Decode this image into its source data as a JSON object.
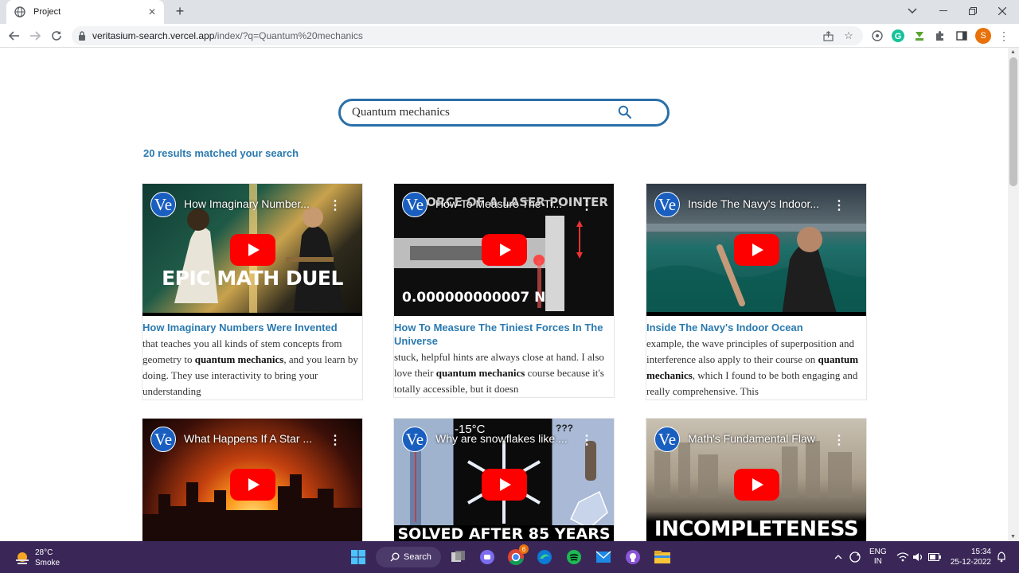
{
  "browser": {
    "tab_title": "Project",
    "url_host": "veritasium-search.vercel.app",
    "url_rest": "/index/?q=Quantum%20mechanics",
    "profile_initial": "S"
  },
  "search": {
    "query": "Quantum mechanics"
  },
  "results_count": "20 results matched your search",
  "cards": [
    {
      "video_title": "How Imaginary Number...",
      "thumb_caption": "EPIC MATH DUEL",
      "title": "How Imaginary Numbers Were Invented",
      "snippet_before": "that teaches you all kinds of stem concepts from geometry to ",
      "snippet_bold": "quantum mechanics",
      "snippet_after": ", and you learn by doing. They use interactivity to bring your understanding"
    },
    {
      "video_title": "How To Measure The Ti...",
      "thumb_caption": "0.000000000007 N",
      "thumb_top_text": "FORCE OF A LASER POINTER",
      "title": "How To Measure The Tiniest Forces In The Universe",
      "snippet_before": "stuck, helpful hints are always close at hand. I also love their ",
      "snippet_bold": "quantum mechanics",
      "snippet_after": " course because it's totally accessible, but it doesn"
    },
    {
      "video_title": "Inside The Navy's Indoor...",
      "thumb_caption": "",
      "title": "Inside The Navy's Indoor Ocean",
      "snippet_before": "example, the wave principles of superposition and interference also apply to their course on ",
      "snippet_bold": "quantum mechanics",
      "snippet_after": ", which I found to be both engaging and really comprehensive. This"
    },
    {
      "video_title": "What Happens If A Star ...",
      "thumb_caption": ""
    },
    {
      "video_title": "Why are snowflakes like ...",
      "thumb_caption": "SOLVED AFTER 85 YEARS",
      "thumb_temp": "-15°C",
      "thumb_q": "???"
    },
    {
      "video_title": "Math's Fundamental Flaw",
      "thumb_caption": "INCOMPLETENESS"
    }
  ],
  "taskbar": {
    "temperature": "28°C",
    "weather": "Smoke",
    "search_label": "Search",
    "lang": "ENG",
    "region": "IN",
    "time": "15:34",
    "date": "25-12-2022",
    "chrome_badge": "6"
  },
  "colors": {
    "accent": "#2a7ab0",
    "search_border": "#2a6fa8",
    "youtube_red": "#ff0000",
    "taskbar": "#3a2758"
  }
}
